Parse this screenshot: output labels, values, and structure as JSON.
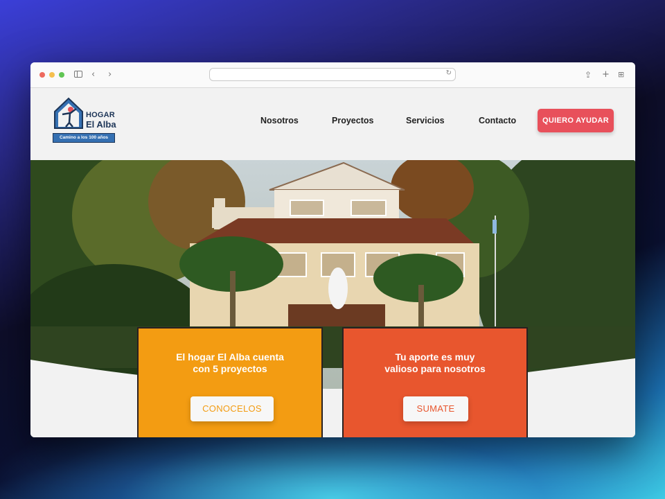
{
  "browser": {
    "url": ""
  },
  "logo": {
    "line1": "HOGAR",
    "line2": "El Alba",
    "tagline": "Camino a los 100 años"
  },
  "nav": {
    "items": [
      {
        "label": "Nosotros"
      },
      {
        "label": "Proyectos"
      },
      {
        "label": "Servicios"
      },
      {
        "label": "Contacto"
      }
    ],
    "cta_label": "QUIERO AYUDAR"
  },
  "cards": [
    {
      "line1": "El hogar El Alba cuenta",
      "line2": "con 5 proyectos",
      "button_label": "CONOCELOS",
      "color": "#f39c12"
    },
    {
      "line1": "Tu aporte es muy",
      "line2": "valioso para nosotros",
      "button_label": "SUMATE",
      "color": "#e8562e"
    }
  ],
  "colors": {
    "cta": "#e8505b",
    "brand_blue": "#1d3557"
  }
}
